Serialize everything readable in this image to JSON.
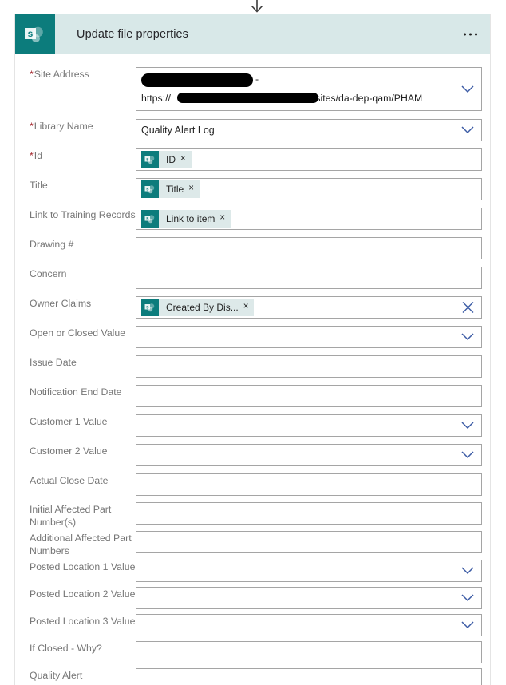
{
  "header": {
    "title": "Update file properties",
    "icon": "sharepoint-icon",
    "more_label": "…",
    "bg_color": "#d8e8e8",
    "icon_color": "#0c7c7c"
  },
  "arrow": {
    "name": "flow-connector-down-arrow"
  },
  "required_marker": "*",
  "token_remove_label": "×",
  "fields": [
    {
      "label": "Site Address",
      "required": true,
      "type": "combo-two-line",
      "value_line1": "",
      "value_line2": "https://",
      "value_line2_suffix": "/sites/da-dep-qam/PHAM",
      "redacted": true,
      "chevron": true
    },
    {
      "label": "Library Name",
      "required": true,
      "type": "combo",
      "value": "Quality Alert Log",
      "chevron": true
    },
    {
      "label": "Id",
      "required": true,
      "type": "token",
      "token": "ID"
    },
    {
      "label": "Title",
      "required": false,
      "type": "token",
      "token": "Title"
    },
    {
      "label": "Link to Training Records",
      "required": false,
      "type": "token",
      "token": "Link to item"
    },
    {
      "label": "Drawing #",
      "required": false,
      "type": "text",
      "value": ""
    },
    {
      "label": "Concern",
      "required": false,
      "type": "text",
      "value": ""
    },
    {
      "label": "Owner Claims",
      "required": false,
      "type": "token-clear",
      "token": "Created By Dis...",
      "clear": true
    },
    {
      "label": "Open or Closed Value",
      "required": false,
      "type": "combo",
      "value": "",
      "chevron": true
    },
    {
      "label": "Issue Date",
      "required": false,
      "type": "text",
      "value": ""
    },
    {
      "label": "Notification End Date",
      "required": false,
      "type": "text",
      "value": ""
    },
    {
      "label": "Customer 1 Value",
      "required": false,
      "type": "combo",
      "value": "",
      "chevron": true
    },
    {
      "label": "Customer 2 Value",
      "required": false,
      "type": "combo",
      "value": "",
      "chevron": true
    },
    {
      "label": "Actual Close Date",
      "required": false,
      "type": "text",
      "value": ""
    },
    {
      "label": "Initial Affected Part\nNumber(s)",
      "required": false,
      "type": "text",
      "value": ""
    },
    {
      "label": "Additional Affected Part\nNumbers",
      "required": false,
      "type": "text",
      "value": ""
    },
    {
      "label": "Posted Location 1 Value",
      "required": false,
      "type": "combo",
      "value": "",
      "chevron": true
    },
    {
      "label": "Posted Location 2 Value",
      "required": false,
      "type": "combo",
      "value": "",
      "chevron": true
    },
    {
      "label": "Posted Location 3 Value",
      "required": false,
      "type": "combo",
      "value": "",
      "chevron": true
    },
    {
      "label": "If Closed - Why?",
      "required": false,
      "type": "text",
      "value": ""
    },
    {
      "label": "Quality Alert",
      "required": false,
      "type": "text",
      "value": ""
    }
  ]
}
